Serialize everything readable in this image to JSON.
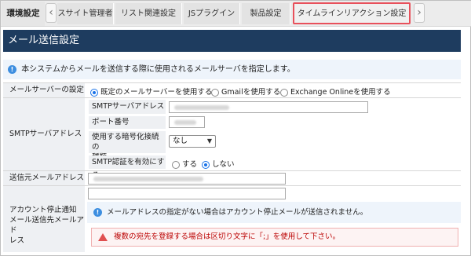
{
  "tabs": {
    "env": "環境設定",
    "items": [
      {
        "label": "スサイト管理者"
      },
      {
        "label": "リスト関連設定"
      },
      {
        "label": "JSプラグイン"
      },
      {
        "label": "製品設定"
      },
      {
        "label": "タイムラインリアクション設定"
      }
    ]
  },
  "section": {
    "title": "メール送信設定"
  },
  "info": {
    "text": "本システムからメールを送信する際に使用されるメールサーバを指定します。"
  },
  "mail_server": {
    "label": "メールサーバーの設定",
    "options": [
      {
        "label": "既定のメールサーバーを使用する",
        "selected": true
      },
      {
        "label": "Gmailを使用する",
        "selected": false
      },
      {
        "label": "Exchange Onlineを使用する",
        "selected": false
      }
    ]
  },
  "smtp": {
    "label": "SMTPサーバアドレス",
    "address_label": "SMTPサーバアドレス",
    "port_label": "ポート番号",
    "encryption_label_1": "使用する暗号化接続の",
    "encryption_label_2": "種類",
    "encryption_value": "なし",
    "auth_label": "SMTP認証を有効にする",
    "auth_yes": "する",
    "auth_no": "しない",
    "auth_selected": "しない"
  },
  "sender": {
    "label": "送信元メールアドレス"
  },
  "stop_notice": {
    "label_1": "アカウント停止通知",
    "label_2": "メール送信先メールアド",
    "label_3": "レス",
    "info": "メールアドレスの指定がない場合はアカウント停止メールが送信されません。",
    "warning": "複数の宛先を登録する場合は区切り文字に「;」を使用して下さい。"
  },
  "colors": {
    "header_bg": "#1e3c5f",
    "info_bg": "#eef4fb",
    "highlight_border": "#e8505b",
    "radio_accent": "#1a73e8",
    "warning_text": "#b00000"
  },
  "icons": [
    "chevron-left-icon",
    "chevron-right-icon",
    "info-icon",
    "warning-icon",
    "select-caret-icon"
  ]
}
